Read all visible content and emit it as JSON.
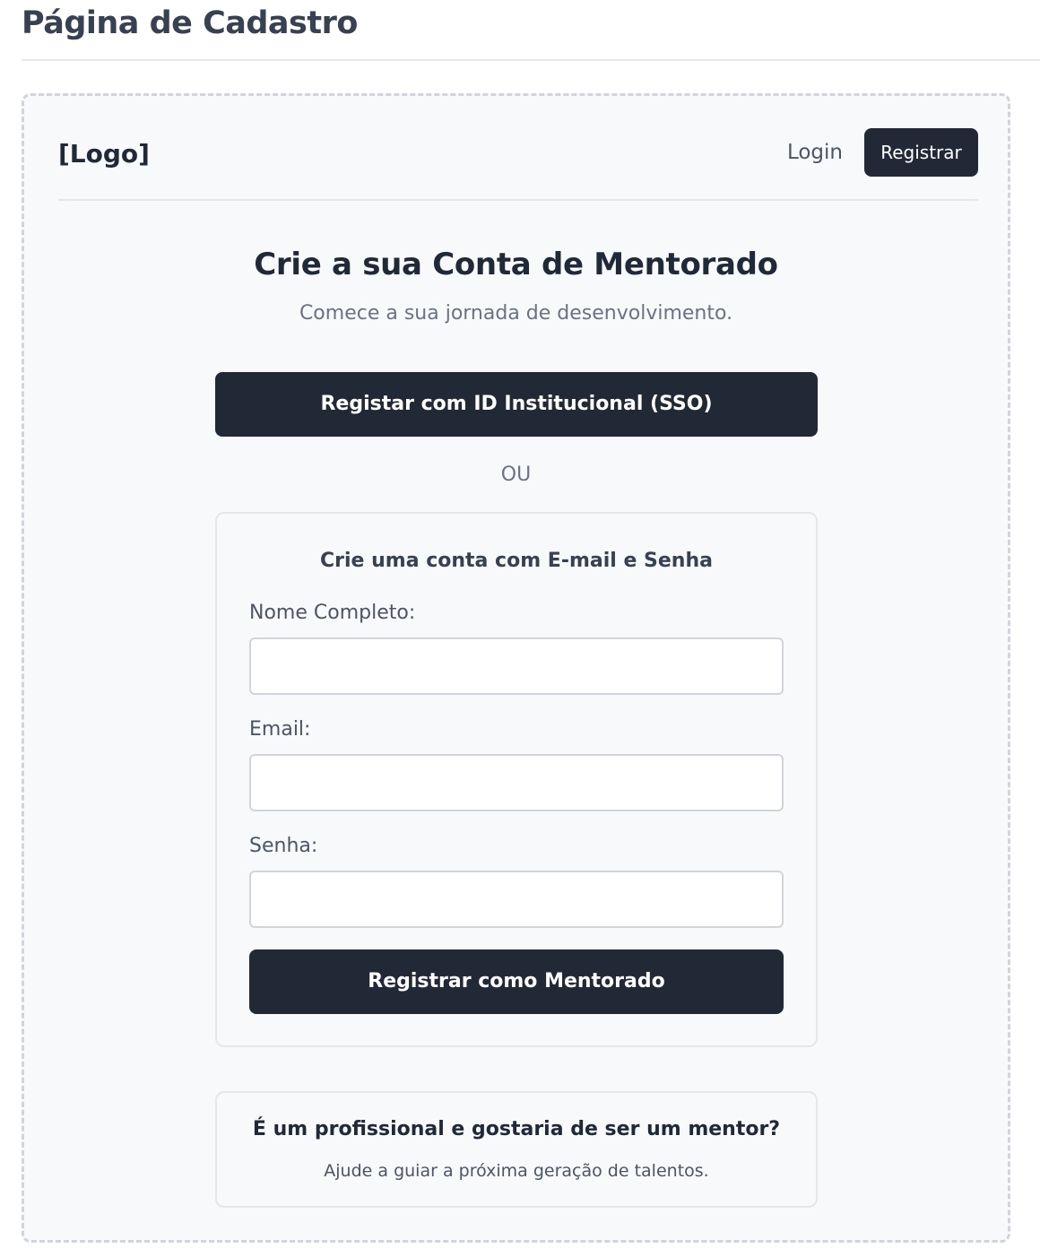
{
  "page": {
    "title": "Página de Cadastro"
  },
  "nav": {
    "logo": "[Logo]",
    "login_label": "Login",
    "register_label": "Registrar"
  },
  "hero": {
    "heading": "Crie a sua Conta de Mentorado",
    "subheading": "Comece a sua jornada de desenvolvimento."
  },
  "sso": {
    "button_label": "Registar com ID Institucional (SSO)"
  },
  "divider": {
    "label": "OU"
  },
  "form": {
    "title": "Crie uma conta com E-mail e Senha",
    "name_label": "Nome Completo:",
    "name_value": "",
    "email_label": "Email:",
    "email_value": "",
    "password_label": "Senha:",
    "password_value": "",
    "submit_label": "Registrar como Mentorado"
  },
  "mentor": {
    "title": "É um profissional e gostaria de ser um mentor?",
    "subtitle": "Ajude a guiar a próxima geração de talentos."
  },
  "colors": {
    "primary_dark": "#222936",
    "frame_bg": "#f8f9fb",
    "border": "#d1d5db",
    "muted_text": "#6b7280"
  }
}
